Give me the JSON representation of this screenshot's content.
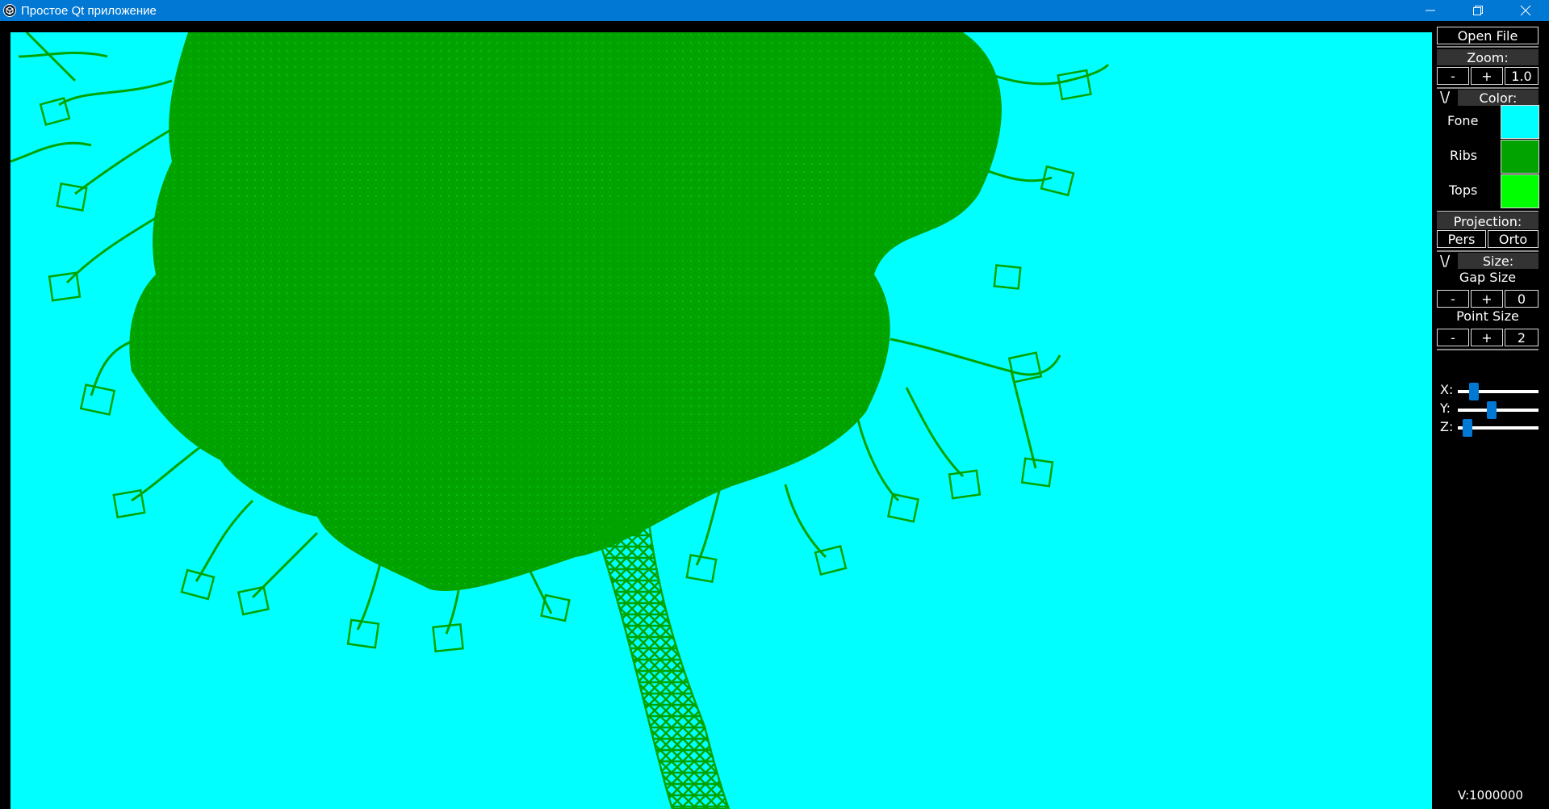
{
  "window": {
    "title": "Простое Qt приложение",
    "icon": "qt-app-icon",
    "controls": [
      "minimize-icon",
      "restore-icon",
      "close-icon"
    ],
    "accent": "#0078d4"
  },
  "viewport": {
    "background_color": "#00ffff",
    "ribs_color": "#00a300",
    "content": "3d-tree-wireframe"
  },
  "panel": {
    "open_file": "Open File",
    "zoom": {
      "header": "Zoom:",
      "minus": "-",
      "plus": "+",
      "value": "1.0"
    },
    "color": {
      "toggle": "\\/",
      "header": "Color:",
      "items": [
        {
          "label": "Fone",
          "color": "#00ffff"
        },
        {
          "label": "Ribs",
          "color": "#00a300"
        },
        {
          "label": "Tops",
          "color": "#00ff00"
        }
      ]
    },
    "projection": {
      "header": "Projection:",
      "pers": "Pers",
      "orto": "Orto"
    },
    "size": {
      "toggle": "\\/",
      "header": "Size:",
      "gap_label": "Gap Size",
      "gap_minus": "-",
      "gap_plus": "+",
      "gap_value": "0",
      "point_label": "Point Size",
      "point_minus": "-",
      "point_plus": "+",
      "point_value": "2"
    },
    "rotation": {
      "x_label": "X:",
      "y_label": "Y:",
      "z_label": "Z:",
      "x_value": 0.2,
      "y_value": 0.42,
      "z_value": 0.12
    },
    "vertices": "V:1000000"
  }
}
